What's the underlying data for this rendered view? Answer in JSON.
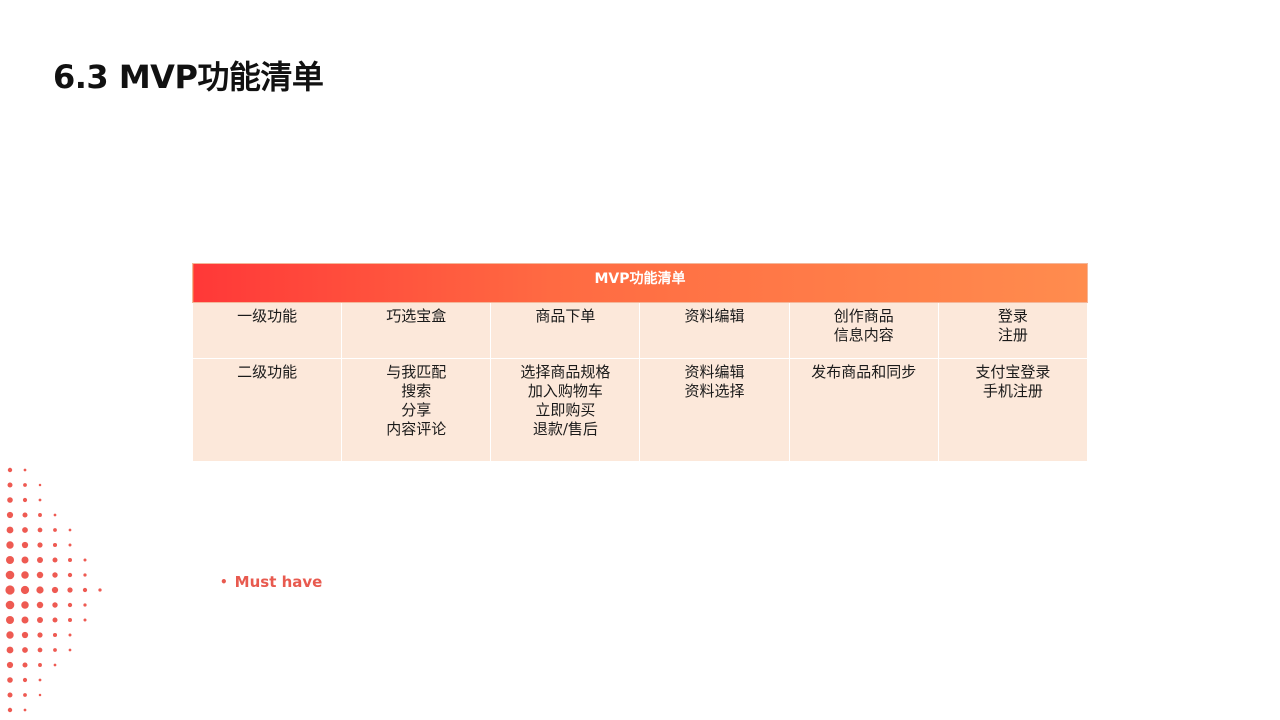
{
  "slide": {
    "title": "6.3 MVP功能清单"
  },
  "table": {
    "header": "MVP功能清单",
    "rows": [
      {
        "label": "一级功能",
        "cells": [
          [
            "巧选宝盒"
          ],
          [
            "商品下单"
          ],
          [
            "资料编辑"
          ],
          [
            "创作商品",
            "信息内容"
          ],
          [
            "登录",
            "注册"
          ]
        ]
      },
      {
        "label": "二级功能",
        "cells": [
          [
            "与我匹配",
            "搜索",
            "分享",
            "内容评论"
          ],
          [
            "选择商品规格",
            "加入购物车",
            "立即购买",
            "退款/售后"
          ],
          [
            "资料编辑",
            "资料选择"
          ],
          [
            "发布商品和同步"
          ],
          [
            "支付宝登录",
            "手机注册"
          ]
        ]
      }
    ]
  },
  "bullet": {
    "text": "Must have"
  },
  "colors": {
    "accent": "#e85a4f",
    "header_gradient_start": "#ff3838",
    "header_gradient_end": "#ff8c4e",
    "cell_bg": "#fce8da",
    "halftone_dot": "#ee5a52"
  }
}
